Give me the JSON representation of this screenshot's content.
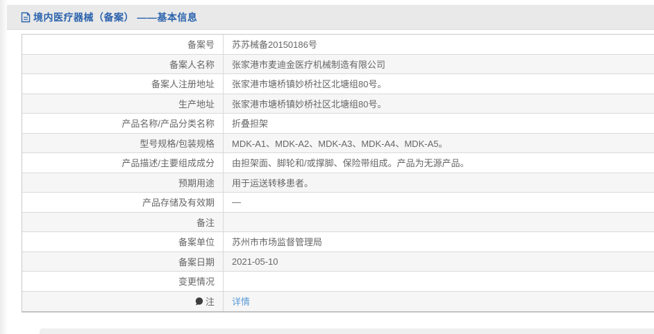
{
  "header": {
    "title": "境内医疗器械（备案） ——基本信息",
    "icon": "document-icon"
  },
  "table": {
    "rows": [
      {
        "label": "备案号",
        "value": "苏苏械备20150186号"
      },
      {
        "label": "备案人名称",
        "value": "张家港市麦迪金医疗机械制造有限公司"
      },
      {
        "label": "备案人注册地址",
        "value": "张家港市塘桥镇妙桥社区北塘组80号。"
      },
      {
        "label": "生产地址",
        "value": "张家港市塘桥镇妙桥社区北塘组80号。"
      },
      {
        "label": "产品名称/产品分类名称",
        "value": "折叠担架"
      },
      {
        "label": "型号规格/包装规格",
        "value": "MDK-A1、MDK-A2、MDK-A3、MDK-A4、MDK-A5。"
      },
      {
        "label": "产品描述/主要组成成分",
        "value": "由担架面、脚轮和/或撑脚、保险带组成。产品为无源产品。"
      },
      {
        "label": "预期用途",
        "value": "用于运送转移患者。"
      },
      {
        "label": "产品存储及有效期",
        "value": "—"
      },
      {
        "label": "备注",
        "value": ""
      },
      {
        "label": "备案单位",
        "value": "苏州市市场监督管理局"
      },
      {
        "label": "备案日期",
        "value": "2021-05-10"
      },
      {
        "label": "变更情况",
        "value": ""
      },
      {
        "label": "注",
        "value": "详情",
        "link": true,
        "note_icon": "speech-bubble-icon"
      }
    ]
  },
  "colors": {
    "title_blue": "#2b63ad",
    "link_blue": "#5b9bd5",
    "header_bg": "#e9e9e9",
    "row_alt_bg": "#f6f6f6",
    "border": "#d9d9d9",
    "text": "#666666"
  }
}
